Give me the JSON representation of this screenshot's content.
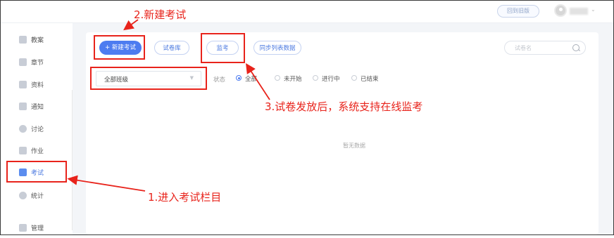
{
  "header": {
    "old_version_btn": "回到旧版",
    "user_caret": "⌄"
  },
  "sidebar": {
    "items": [
      {
        "label": "教案",
        "icon": "document-icon"
      },
      {
        "label": "章节",
        "icon": "chapter-icon"
      },
      {
        "label": "资料",
        "icon": "folder-icon"
      },
      {
        "label": "通知",
        "icon": "speaker-icon"
      },
      {
        "label": "讨论",
        "icon": "chat-icon"
      },
      {
        "label": "作业",
        "icon": "edit-icon"
      },
      {
        "label": "考试",
        "icon": "exam-icon",
        "active": true
      },
      {
        "label": "统计",
        "icon": "pie-chart-icon"
      },
      {
        "label": "管理",
        "icon": "gear-icon"
      }
    ]
  },
  "toolbar": {
    "new_exam": "+ 新建考试",
    "paper_bank": "试卷库",
    "proctor": "监考",
    "sync_list": "同步列表数据",
    "search_placeholder": "试卷名"
  },
  "filter": {
    "class_select": "全部班级",
    "status_label": "状态",
    "options": [
      "全部",
      "未开始",
      "进行中",
      "已结束"
    ],
    "selected": "全部"
  },
  "content": {
    "empty_text": "暂无数据"
  },
  "annotations": {
    "step1": "1.进入考试栏目",
    "step2": "2.新建考试",
    "step3": "3.试卷发放后，系统支持在线监考"
  },
  "colors": {
    "accent": "#4d7cf0",
    "annotation": "#e8231b"
  }
}
